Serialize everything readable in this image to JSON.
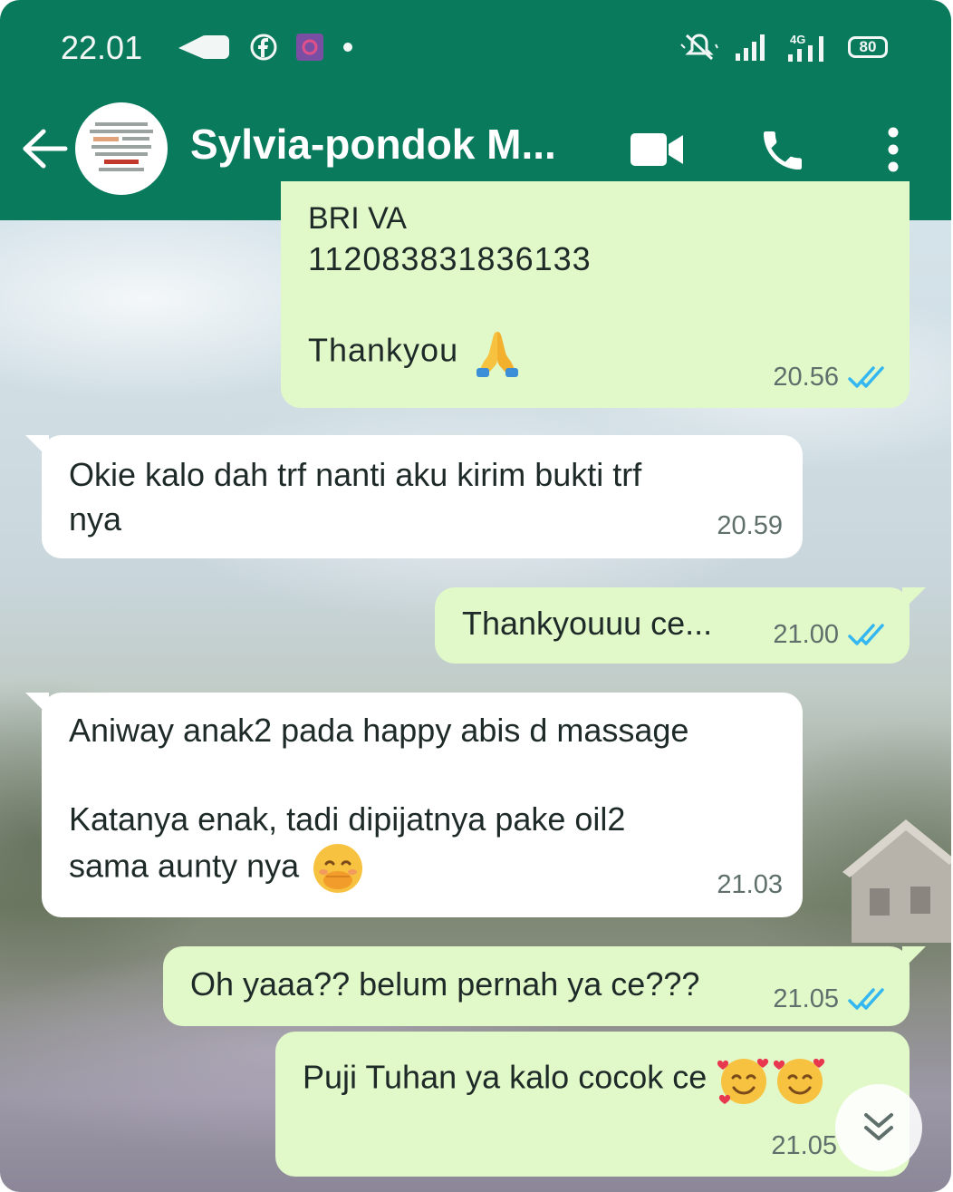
{
  "status_bar": {
    "time": "22.01",
    "battery": "80",
    "network": "4G"
  },
  "header": {
    "contact_name": "Sylvia-pondok M...",
    "icons": [
      "back-arrow-icon",
      "avatar",
      "video-call-icon",
      "phone-icon",
      "more-vert-icon"
    ]
  },
  "colors": {
    "header": "#0a7a5c",
    "incoming_bubble": "#ffffff",
    "outgoing_bubble": "#e1f8c9",
    "read_ticks": "#34b7f1"
  },
  "messages": [
    {
      "direction": "out",
      "cut_top_text": "BRI VA",
      "text": "112083831836133\n\nThankyou",
      "emoji": "folded-hands",
      "time": "20.56",
      "read": true
    },
    {
      "direction": "in",
      "text": "Okie kalo dah trf nanti aku kirim bukti trf\nnya",
      "time": "20.59"
    },
    {
      "direction": "out",
      "text": "Thankyouuu ce...",
      "time": "21.00",
      "read": true
    },
    {
      "direction": "in",
      "text": "Aniway anak2 pada happy abis d massage\n\nKatanya enak, tadi dipijatnya pake oil2\nsama aunty nya",
      "emoji": "face-hand-over-mouth",
      "time": "21.03"
    },
    {
      "direction": "out",
      "text": "Oh yaaa?? belum pernah ya ce???",
      "time": "21.05",
      "read": true
    },
    {
      "direction": "out",
      "text": "Puji Tuhan ya kalo cocok ce",
      "emoji": "smiling-face-with-hearts x2",
      "time": "21.05",
      "read": true
    }
  ],
  "scroll_button": {
    "icon": "double-chevron-down-icon"
  }
}
